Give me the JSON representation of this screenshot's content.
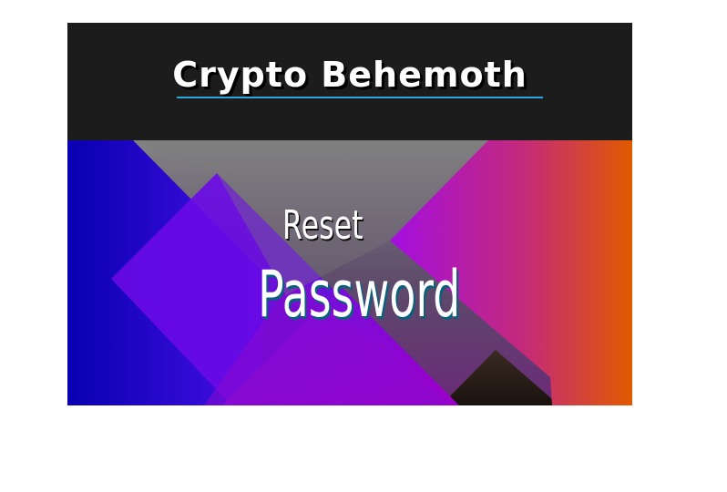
{
  "brand": {
    "title": "Crypto Behemoth",
    "underline_color": "#2aa6d9",
    "header_background": "#1c1c1c"
  },
  "hero": {
    "line1": "Reset",
    "line2": "Password"
  },
  "colors": {
    "blue": "#0a00b8",
    "purple": "#a000d8",
    "orange": "#de5a00",
    "gray": "#7f7f7f"
  }
}
